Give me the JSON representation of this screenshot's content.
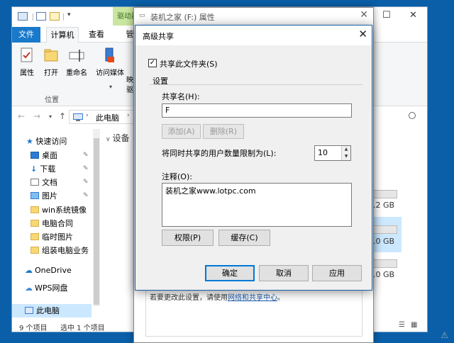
{
  "explorer": {
    "drive_tools_tab": "驱动器",
    "tabs": [
      "文件",
      "计算机",
      "查看"
    ],
    "tab_partial": "管",
    "ribbon_buttons": [
      "属性",
      "打开",
      "重命名",
      "访问媒体"
    ],
    "ribbon_partial": [
      "映",
      "驱"
    ],
    "group_label": "位置",
    "address": "此电脑",
    "section_partial": "设备",
    "nav_items": [
      {
        "label": "快速访问",
        "icon": "star-icon"
      },
      {
        "label": "桌面",
        "icon": "desktop-icon",
        "pinned": true
      },
      {
        "label": "下载",
        "icon": "download-icon",
        "pinned": true
      },
      {
        "label": "文档",
        "icon": "document-icon",
        "pinned": true
      },
      {
        "label": "图片",
        "icon": "picture-icon",
        "pinned": true
      },
      {
        "label": "win系统镜像",
        "icon": "folder-icon"
      },
      {
        "label": "电脑合同",
        "icon": "folder-icon"
      },
      {
        "label": "临时图片",
        "icon": "folder-icon"
      },
      {
        "label": "组装电脑业务",
        "icon": "folder-icon"
      },
      {
        "label": "OneDrive",
        "icon": "cloud-icon"
      },
      {
        "label": "WPS网盘",
        "icon": "cloud-icon"
      },
      {
        "label": "此电脑",
        "icon": "computer-icon",
        "selected": true
      }
    ],
    "drive_sizes": [
      ".2 GB",
      ".0 GB",
      ".0 GB"
    ],
    "status_items": "9 个项目",
    "status_selected": "选中 1 个项目"
  },
  "properties": {
    "title": "装机之家 (F:) 属性",
    "change_text": "若要更改此设置，请使用",
    "change_link": "网络和共享中心",
    "change_suffix": "。"
  },
  "advanced_sharing": {
    "title": "高级共享",
    "share_checkbox_label": "共享此文件夹(S)",
    "share_checked": true,
    "settings_group": "设置",
    "share_name_label": "共享名(H):",
    "share_name_value": "F",
    "add_button": "添加(A)",
    "remove_button": "删除(R)",
    "user_limit_label": "将同时共享的用户数量限制为(L):",
    "user_limit_value": "10",
    "comment_label": "注释(O):",
    "comment_value": "装机之家www.lotpc.com",
    "permissions_button": "权限(P)",
    "caching_button": "缓存(C)",
    "ok_button": "确定",
    "cancel_button": "取消",
    "apply_button": "应用"
  }
}
